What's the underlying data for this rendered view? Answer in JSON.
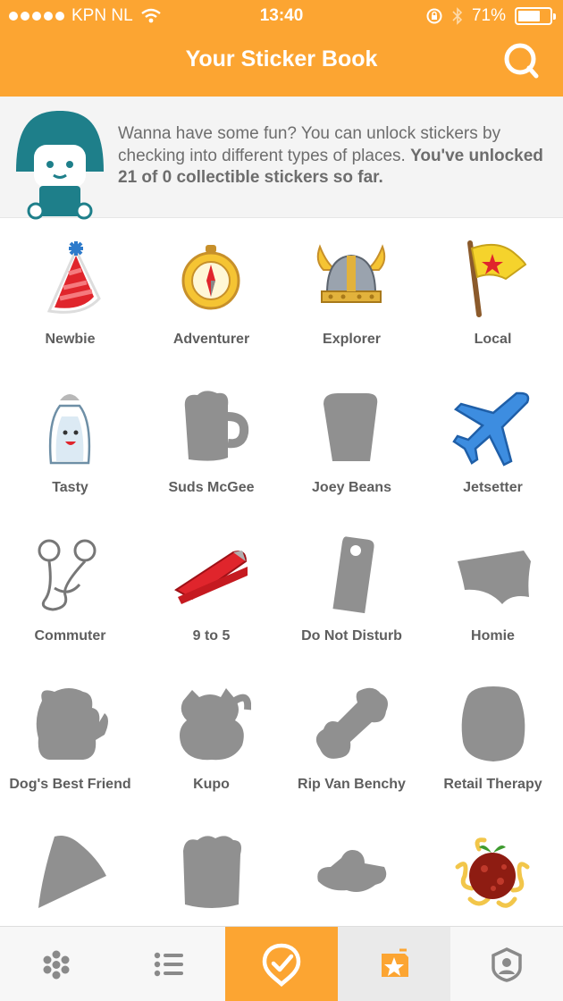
{
  "status_bar": {
    "carrier": "KPN NL",
    "time": "13:40",
    "battery": "71%",
    "battery_level": 0.71
  },
  "header": {
    "title": "Your Sticker Book",
    "search_icon": "search-icon"
  },
  "intro": {
    "text_plain": "Wanna have some fun? You can unlock stickers by checking into different types of places. ",
    "text_bold": "You've unlocked 21 of 0 collectible stickers so far."
  },
  "stickers": [
    {
      "label": "Newbie",
      "icon": "party-hat-icon",
      "locked": false
    },
    {
      "label": "Adventurer",
      "icon": "compass-icon",
      "locked": false
    },
    {
      "label": "Explorer",
      "icon": "viking-helmet-icon",
      "locked": false
    },
    {
      "label": "Local",
      "icon": "flag-icon",
      "locked": false
    },
    {
      "label": "Tasty",
      "icon": "salt-shaker-icon",
      "locked": false
    },
    {
      "label": "Suds McGee",
      "icon": "beer-mug-locked-icon",
      "locked": true
    },
    {
      "label": "Joey Beans",
      "icon": "coffee-cup-locked-icon",
      "locked": true
    },
    {
      "label": "Jetsetter",
      "icon": "airplane-icon",
      "locked": false
    },
    {
      "label": "Commuter",
      "icon": "earbuds-icon",
      "locked": false
    },
    {
      "label": "9 to 5",
      "icon": "stapler-icon",
      "locked": false
    },
    {
      "label": "Do Not Disturb",
      "icon": "door-hanger-locked-icon",
      "locked": true
    },
    {
      "label": "Homie",
      "icon": "underwear-locked-icon",
      "locked": true
    },
    {
      "label": "Dog's Best Friend",
      "icon": "dog-locked-icon",
      "locked": true
    },
    {
      "label": "Kupo",
      "icon": "cat-locked-icon",
      "locked": true
    },
    {
      "label": "Rip Van Benchy",
      "icon": "dumbbell-locked-icon",
      "locked": true
    },
    {
      "label": "Retail Therapy",
      "icon": "jar-locked-icon",
      "locked": true
    },
    {
      "label": "",
      "icon": "pizza-slice-locked-icon",
      "locked": true
    },
    {
      "label": "",
      "icon": "cupcake-locked-icon",
      "locked": true
    },
    {
      "label": "",
      "icon": "sombrero-locked-icon",
      "locked": true
    },
    {
      "label": "",
      "icon": "meatball-spaghetti-icon",
      "locked": false
    }
  ],
  "tabbar": [
    {
      "name": "explore",
      "icon": "flower-dots-icon"
    },
    {
      "name": "feed",
      "icon": "list-icon"
    },
    {
      "name": "check-in",
      "icon": "location-checkmark-icon"
    },
    {
      "name": "stickers",
      "icon": "sticker-star-icon"
    },
    {
      "name": "profile",
      "icon": "profile-badge-icon"
    }
  ],
  "colors": {
    "accent": "#FCA532",
    "mascot": "#1E7F8A",
    "locked": "#909090",
    "text": "#5e5e5e"
  }
}
